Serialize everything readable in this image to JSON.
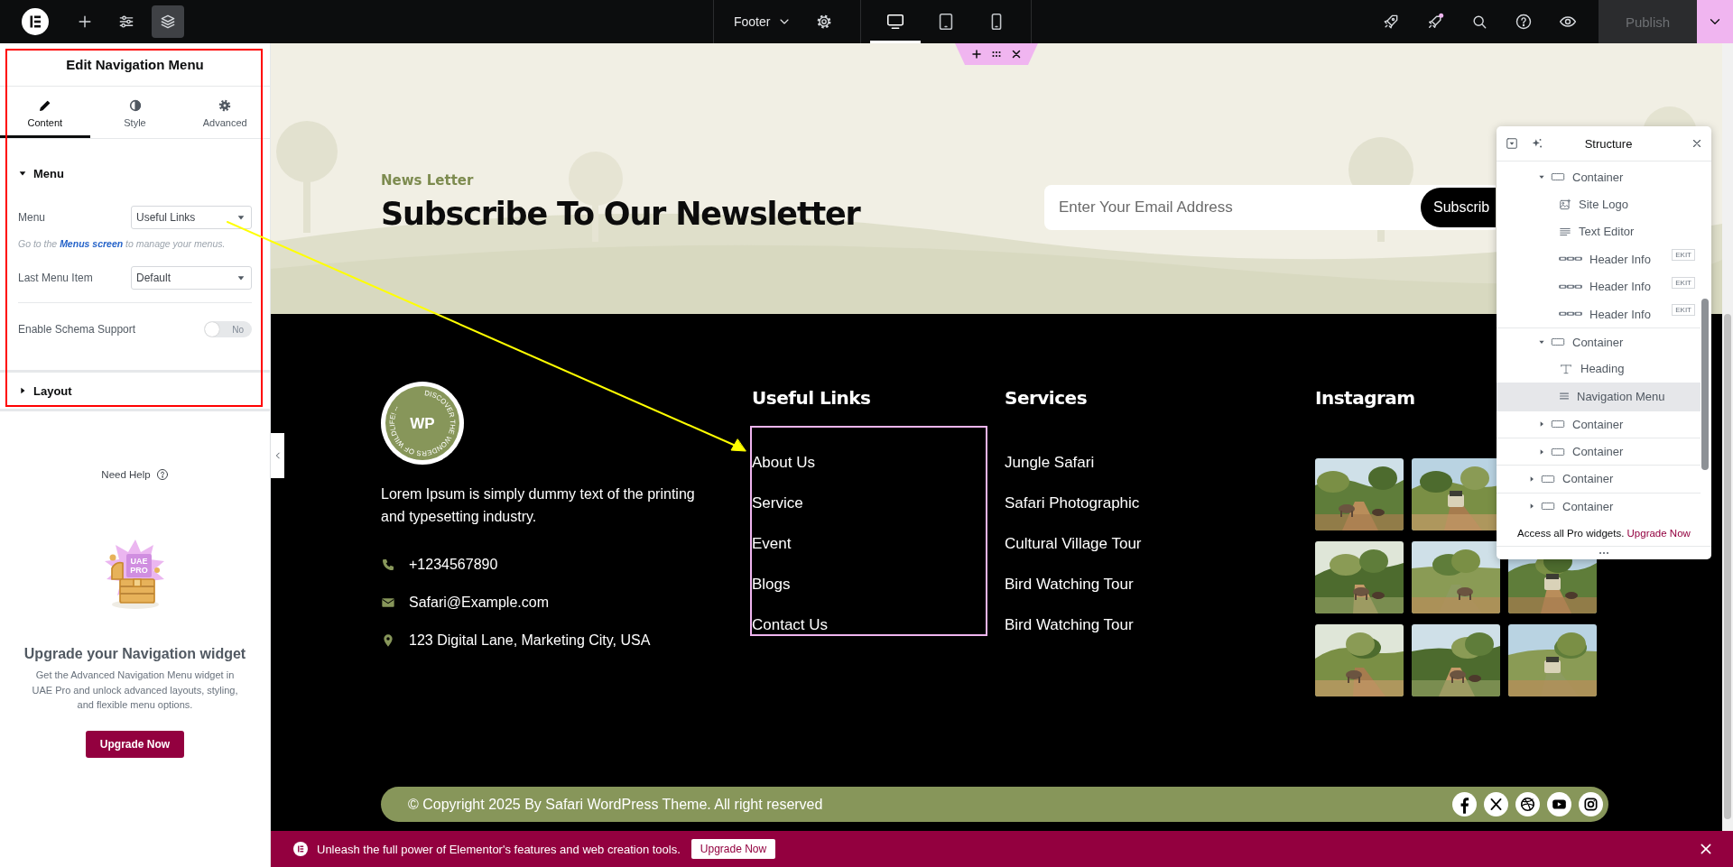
{
  "topbar": {
    "left_tools": [
      {
        "kind": "add",
        "selected": false
      },
      {
        "kind": "settings",
        "selected": false
      },
      {
        "kind": "layers",
        "selected": true
      }
    ],
    "document": "Footer",
    "devices": [
      {
        "kind": "desktop",
        "selected": true
      },
      {
        "kind": "tablet",
        "selected": false
      },
      {
        "kind": "mobile",
        "selected": false
      }
    ],
    "right_tools": [
      {
        "kind": "launch",
        "notify": false
      },
      {
        "kind": "whats-new",
        "notify": true
      },
      {
        "kind": "search",
        "notify": false
      },
      {
        "kind": "help",
        "notify": false
      },
      {
        "kind": "preview",
        "notify": false
      }
    ],
    "publish": {
      "label": "Publish",
      "disabled": true
    }
  },
  "panel": {
    "title": "Edit Navigation Menu",
    "tabs": [
      {
        "label": "Content",
        "kind": "pencil",
        "selected": true
      },
      {
        "label": "Style",
        "kind": "contrast",
        "selected": false
      },
      {
        "label": "Advanced",
        "kind": "gear",
        "selected": false
      }
    ],
    "sections": [
      {
        "title": "Menu",
        "expanded": true,
        "controls": [
          {
            "kind": "select",
            "label": "Menu",
            "value": "Useful Links"
          },
          {
            "kind": "note",
            "before": "Go to the",
            "link": "Menus screen",
            "after": "to manage your menus."
          },
          {
            "kind": "select",
            "label": "Last Menu Item",
            "value": "Default"
          },
          {
            "kind": "divider"
          },
          {
            "kind": "switch",
            "label": "Enable Schema Support",
            "on": false,
            "state_label": "No"
          }
        ]
      },
      {
        "title": "Layout",
        "expanded": false
      }
    ],
    "help": "Need Help",
    "upsell": {
      "art_lines": [
        "UAE",
        "PRO"
      ],
      "title": "Upgrade your Navigation widget",
      "text": "Get the Advanced Navigation Menu widget in UAE Pro and unlock advanced layouts, styling, and flexible menu options.",
      "button": "Upgrade Now"
    }
  },
  "page": {
    "newsletter": {
      "eyebrow": "News Letter",
      "heading": "Subscribe To Our Newsletter",
      "email_placeholder": "Enter Your Email Address",
      "button": "Subscrib"
    },
    "about": {
      "logo": {
        "initials": "WP",
        "ring": "DISCOVER THE WONDERS OF WILDLIFE! --"
      },
      "text": "Lorem Ipsum is simply dummy text of the printing and typesetting industry.",
      "contacts": [
        {
          "kind": "phone",
          "text": "+1234567890"
        },
        {
          "kind": "mail",
          "text": "Safari@Example.com"
        },
        {
          "kind": "pin",
          "text": "123 Digital Lane, Marketing City, USA"
        }
      ]
    },
    "columns": [
      {
        "heading": "Useful Links",
        "selected": true,
        "links": [
          "About Us",
          "Service",
          "Event",
          "Blogs",
          "Contact Us"
        ]
      },
      {
        "heading": "Services",
        "selected": false,
        "links": [
          "Jungle Safari",
          "Safari Photographic",
          "Cultural Village Tour",
          "Bird Watching Tour",
          "Bird Watching Tour"
        ]
      }
    ],
    "instagram": {
      "heading": "Instagram"
    },
    "copyright": "© Copyright 2025 By Safari WordPress Theme. All right reserved",
    "socials": [
      {
        "kind": "facebook"
      },
      {
        "kind": "x"
      },
      {
        "kind": "dribbble"
      },
      {
        "kind": "youtube"
      },
      {
        "kind": "instagram"
      }
    ]
  },
  "structure": {
    "title": "Structure",
    "items": [
      {
        "children": [
          {
            "label": "Container",
            "kind": "container",
            "expanded": true,
            "selected": false,
            "children": [
              {
                "label": "Site Logo",
                "kind": "logo",
                "selected": false
              },
              {
                "label": "Text Editor",
                "kind": "text",
                "selected": false
              },
              {
                "label": "Header Info",
                "kind": "info",
                "badge": "EKIT",
                "selected": false
              },
              {
                "label": "Header Info",
                "kind": "info",
                "badge": "EKIT",
                "selected": false
              },
              {
                "label": "Header Info",
                "kind": "info",
                "badge": "EKIT",
                "selected": false
              }
            ]
          },
          {
            "label": "Container",
            "kind": "container",
            "expanded": true,
            "selected": false,
            "children": [
              {
                "label": "Heading",
                "kind": "heading",
                "selected": false
              },
              {
                "label": "Navigation Menu",
                "kind": "menu",
                "selected": true
              }
            ]
          },
          {
            "label": "Container",
            "kind": "container",
            "expanded": false,
            "selected": false
          },
          {
            "label": "Container",
            "kind": "container",
            "expanded": false,
            "selected": false
          }
        ]
      },
      {
        "label": "Container",
        "kind": "container",
        "expanded": false,
        "selected": false
      },
      {
        "label": "Container",
        "kind": "container",
        "expanded": false,
        "selected": false
      }
    ],
    "footer_text": "Access all Pro widgets.",
    "footer_link": "Upgrade Now"
  },
  "promo_bar": {
    "text": "Unleash the full power of Elementor's features and web creation tools.",
    "button": "Upgrade Now"
  }
}
